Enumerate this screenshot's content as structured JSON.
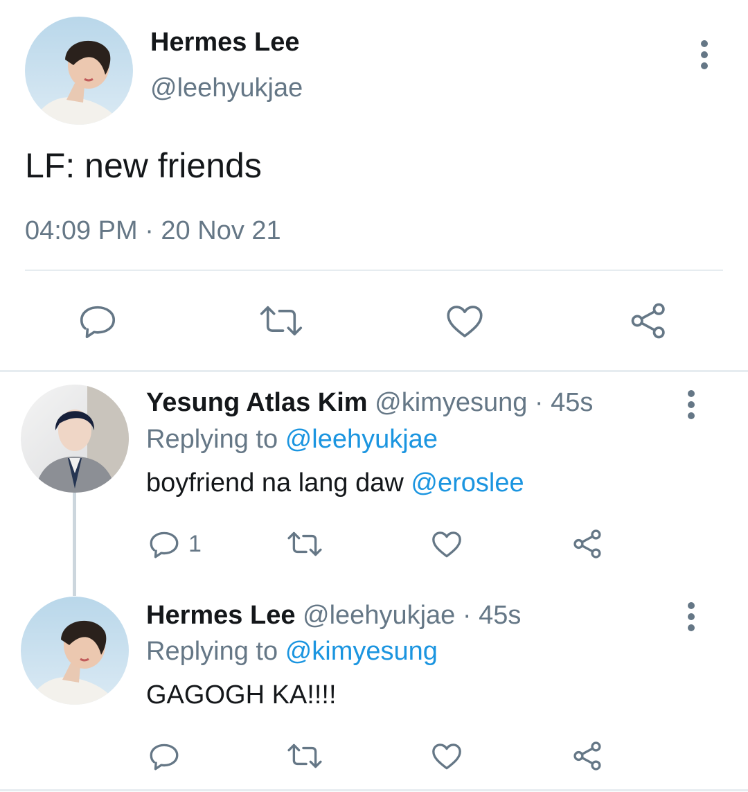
{
  "main_tweet": {
    "author_name": "Hermes Lee",
    "handle": "@leehyukjae",
    "text": "LF: new friends",
    "timestamp": "04:09 PM · 20 Nov 21"
  },
  "replies": [
    {
      "author_name": "Yesung Atlas Kim",
      "handle_time": "@kimyesung · 45s",
      "replying_prefix": "Replying to",
      "replying_handle": "@leehyukjae",
      "text": "boyfriend na lang daw",
      "mention": "@eroslee",
      "reply_count": "1"
    },
    {
      "author_name": "Hermes Lee",
      "handle_time": "@leehyukjae · 45s",
      "replying_prefix": "Replying to",
      "replying_handle": "@kimyesung",
      "text": "GAGOGH KA!!!!",
      "reply_count": ""
    }
  ],
  "icons": [
    "reply-icon",
    "retweet-icon",
    "like-icon",
    "share-icon",
    "more-icon"
  ],
  "colors": {
    "text": "#14171a",
    "secondary": "#657786",
    "link": "#1b95e0",
    "divider": "#e6ecf0"
  }
}
